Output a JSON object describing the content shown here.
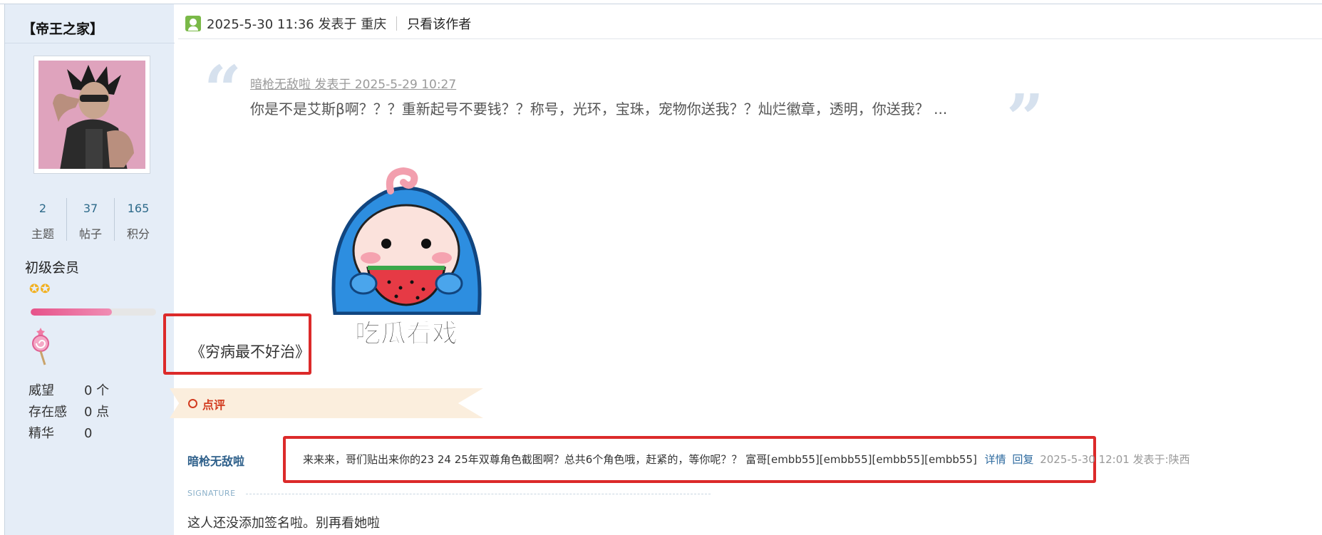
{
  "sidebar": {
    "username": "【帝王之家】",
    "stats": [
      {
        "value": "2",
        "label": "主题"
      },
      {
        "value": "37",
        "label": "帖子"
      },
      {
        "value": "165",
        "label": "积分"
      }
    ],
    "rank": "初级会员",
    "rank_stars": "✪✪",
    "level_progress": 0.65,
    "medal_icon": "lollipop-icon",
    "props": [
      {
        "key": "威望",
        "value": "0 个"
      },
      {
        "key": "存在感",
        "value": "0 点"
      },
      {
        "key": "精华",
        "value": "0"
      }
    ]
  },
  "post": {
    "icon": "user-icon",
    "time_location": "2025-5-30 11:36 发表于 重庆",
    "only_author_label": "只看该作者",
    "quote": {
      "meta": "暗枪无敌啦 发表于 2025-5-29 10:27",
      "text": "你是不是艾斯β啊？？？重新起号不要钱？？称号，光环，宝珠，宠物你送我？？灿烂徽章，透明，你送我？ ..."
    },
    "sticker_caption": "吃瓜看戏",
    "sticker_icon": "watermelon-eating-sticker",
    "body_text": "《穷病最不好治》"
  },
  "comments": {
    "banner_label": "点评",
    "items": [
      {
        "user": "暗枪无敌啦",
        "text": "来来来，哥们贴出来你的23 24 25年双尊角色截图啊？总共6个角色哦，赶紧的，等你呢？？ 富哥[embb55][embb55][embb55][embb55]",
        "detail_label": "详情",
        "reply_label": "回复",
        "time": "2025-5-30 12:01 发表于:陕西"
      }
    ]
  },
  "signature": {
    "label": "SIGNATURE",
    "text": "这人还没添加签名啦。别再看她啦"
  },
  "colors": {
    "sidebar_bg": "#e5edf7",
    "highlight": "#dc2a2a",
    "link": "#2d6a9f",
    "comment_accent": "#d23b1f"
  }
}
